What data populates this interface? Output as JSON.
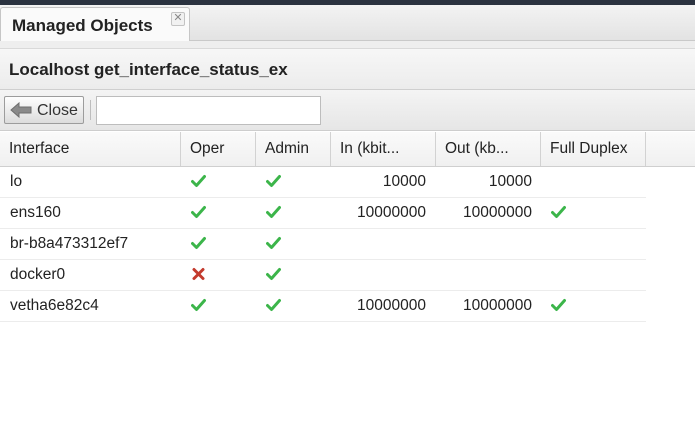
{
  "tab": {
    "label": "Managed Objects",
    "close_icon": "close-icon"
  },
  "panel": {
    "title": "Localhost get_interface_status_ex"
  },
  "toolbar": {
    "close_label": "Close",
    "close_icon": "arrow-left-icon",
    "search_value": ""
  },
  "colors": {
    "ok": "#3cb54a",
    "error": "#c33a2d"
  },
  "grid": {
    "columns": [
      "Interface",
      "Oper",
      "Admin",
      "In (kbit...",
      "Out (kb...",
      "Full Duplex"
    ],
    "rows": [
      {
        "interface": "lo",
        "oper": "check",
        "admin": "check",
        "in": "10000",
        "out": "10000",
        "full_duplex": ""
      },
      {
        "interface": "ens160",
        "oper": "check",
        "admin": "check",
        "in": "10000000",
        "out": "10000000",
        "full_duplex": "check"
      },
      {
        "interface": "br-b8a473312ef7",
        "oper": "check",
        "admin": "check",
        "in": "",
        "out": "",
        "full_duplex": ""
      },
      {
        "interface": "docker0",
        "oper": "cross",
        "admin": "check",
        "in": "",
        "out": "",
        "full_duplex": ""
      },
      {
        "interface": "vetha6e82c4",
        "oper": "check",
        "admin": "check",
        "in": "10000000",
        "out": "10000000",
        "full_duplex": "check"
      }
    ]
  }
}
